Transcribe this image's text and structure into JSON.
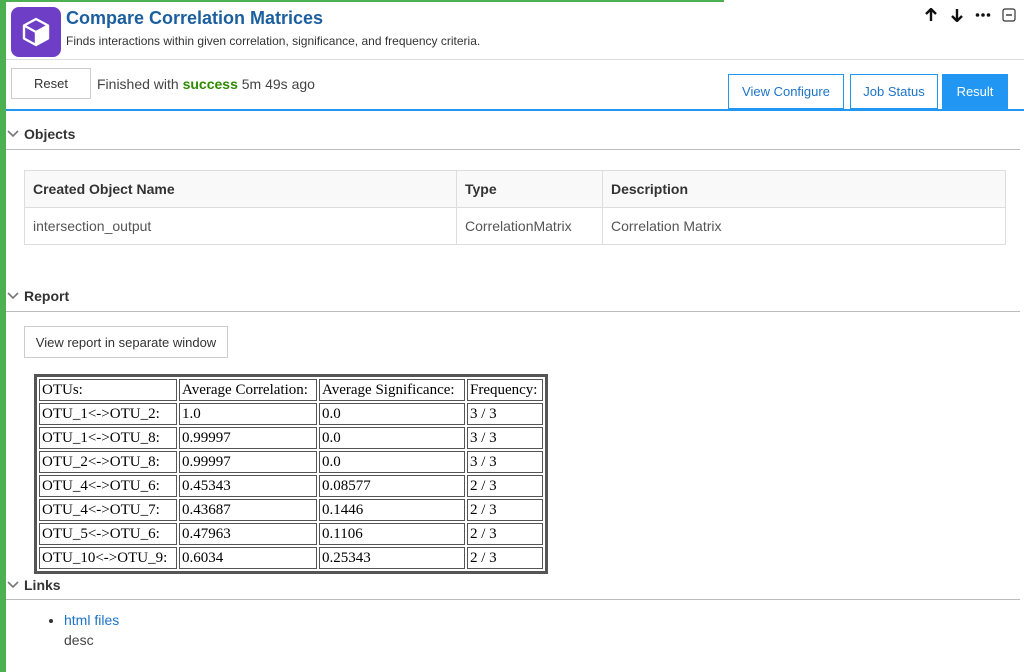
{
  "app": {
    "title": "Compare Correlation Matrices",
    "subtitle": "Finds interactions within given correlation, significance, and frequency criteria."
  },
  "header_controls": [
    "arrow-up-icon",
    "arrow-down-icon",
    "more-icon",
    "collapse-icon"
  ],
  "toolbar": {
    "reset_label": "Reset",
    "status_prefix": "Finished with",
    "status_word": "success",
    "status_suffix": "5m 49s ago",
    "tabs": [
      {
        "label": "View Configure"
      },
      {
        "label": "Job Status"
      },
      {
        "label": "Result"
      }
    ]
  },
  "objects": {
    "title": "Objects",
    "headers": [
      "Created Object Name",
      "Type",
      "Description"
    ],
    "rows": [
      {
        "name": "intersection_output",
        "type": "CorrelationMatrix",
        "description": "Correlation Matrix"
      }
    ]
  },
  "report": {
    "title": "Report",
    "view_button": "View report in separate window",
    "table_headers": [
      "OTUs:",
      "Average Correlation:",
      "Average Significance:",
      "Frequency:"
    ],
    "rows": [
      [
        "OTU_1<->OTU_2:",
        "1.0",
        "0.0",
        "3 / 3"
      ],
      [
        "OTU_1<->OTU_8:",
        "0.99997",
        "0.0",
        "3 / 3"
      ],
      [
        "OTU_2<->OTU_8:",
        "0.99997",
        "0.0",
        "3 / 3"
      ],
      [
        "OTU_4<->OTU_6:",
        "0.45343",
        "0.08577",
        "2 / 3"
      ],
      [
        "OTU_4<->OTU_7:",
        "0.43687",
        "0.1446",
        "2 / 3"
      ],
      [
        "OTU_5<->OTU_6:",
        "0.47963",
        "0.1106",
        "2 / 3"
      ],
      [
        "OTU_10<->OTU_9:",
        "0.6034",
        "0.25343",
        "2 / 3"
      ]
    ]
  },
  "links": {
    "title": "Links",
    "items": [
      {
        "label": "html files",
        "desc": "desc"
      }
    ]
  },
  "colors": {
    "accent": "#2196f3",
    "success": "#2e8b00",
    "status_bar": "#4caf50",
    "app_icon": "#6f3ec7"
  }
}
